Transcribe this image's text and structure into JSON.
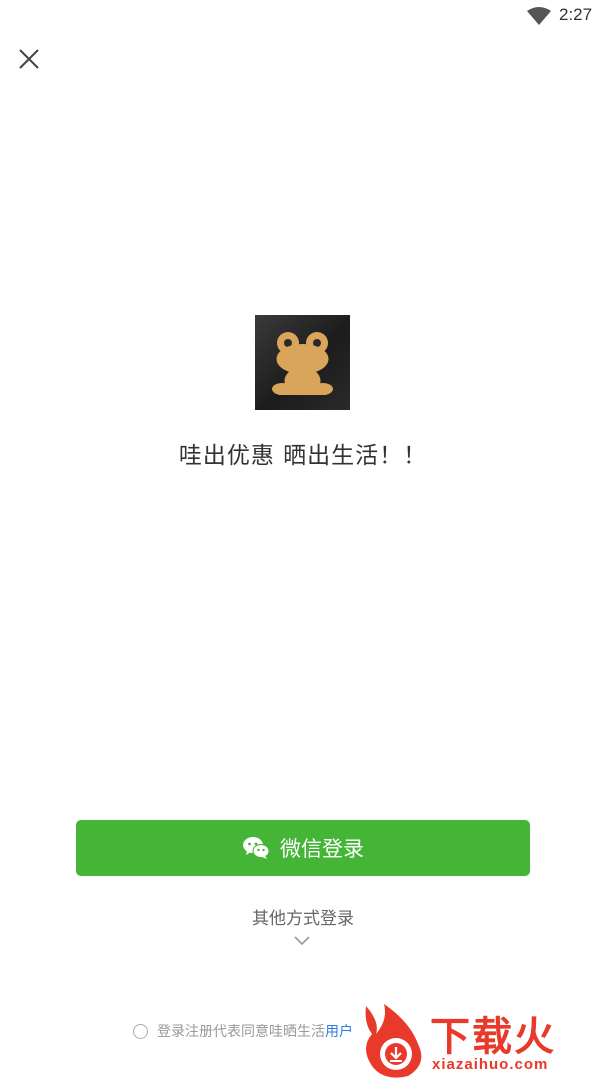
{
  "status_bar": {
    "time": "2:27"
  },
  "header": {
    "close_icon": "close-icon"
  },
  "app": {
    "logo_icon": "frog-logo-icon",
    "slogan": "哇出优惠 晒出生活！！"
  },
  "login": {
    "wechat_label": "微信登录",
    "wechat_icon": "wechat-icon",
    "other_label": "其他方式登录",
    "expand_icon": "chevron-down-icon"
  },
  "agreement": {
    "text": "登录注册代表同意哇晒生活",
    "link": "用户"
  },
  "watermark": {
    "title": "下载火",
    "subtitle": "xiazaihuo.com"
  },
  "colors": {
    "primary_green": "#44b536",
    "link_blue": "#2b7de9",
    "logo_gold": "#d9a55b",
    "watermark_red": "#e8392a"
  }
}
